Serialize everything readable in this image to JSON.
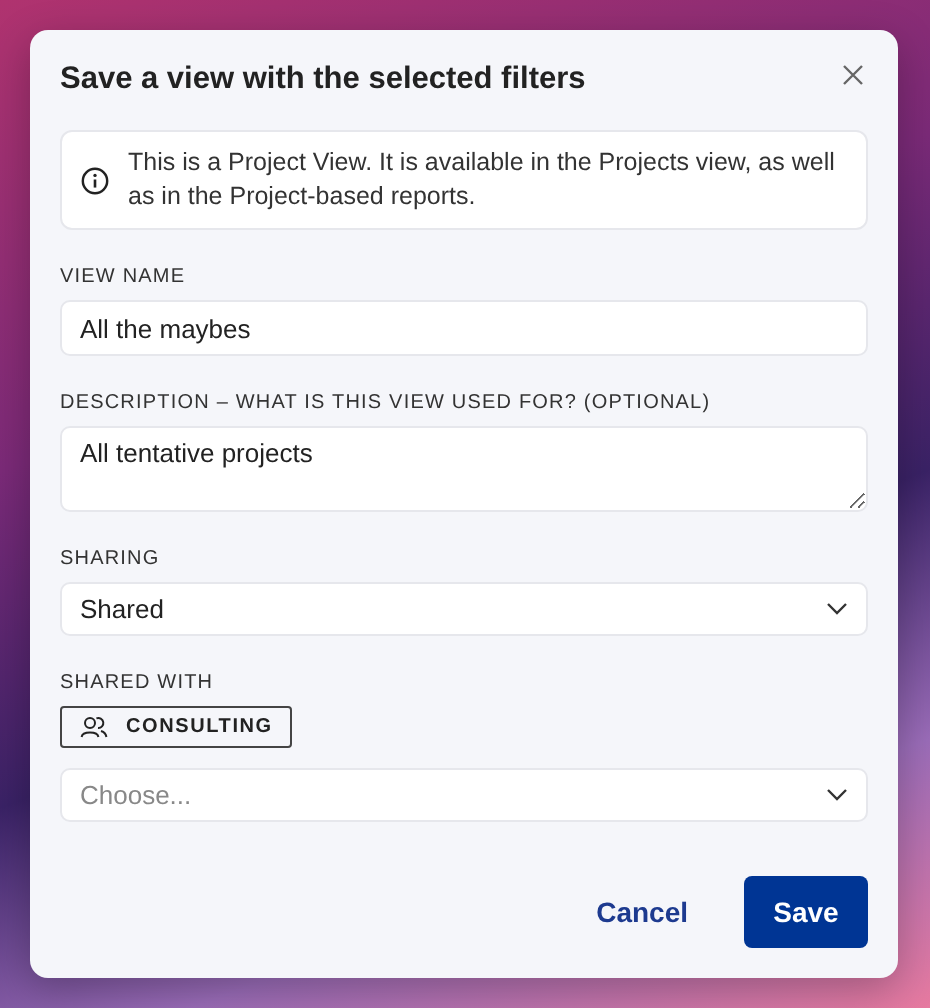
{
  "dialog": {
    "title": "Save a view with the selected filters",
    "info": "This is a Project View. It is available in the Projects view, as well as in the Project-based reports.",
    "view_name": {
      "label": "VIEW NAME",
      "value": "All the maybes"
    },
    "description": {
      "label": "DESCRIPTION – WHAT IS THIS VIEW USED FOR? (OPTIONAL)",
      "value": "All tentative projects"
    },
    "sharing": {
      "label": "SHARING",
      "value": "Shared"
    },
    "shared_with": {
      "label": "SHARED WITH",
      "tags": [
        "CONSULTING"
      ],
      "placeholder": "Choose..."
    },
    "buttons": {
      "cancel": "Cancel",
      "save": "Save"
    }
  }
}
